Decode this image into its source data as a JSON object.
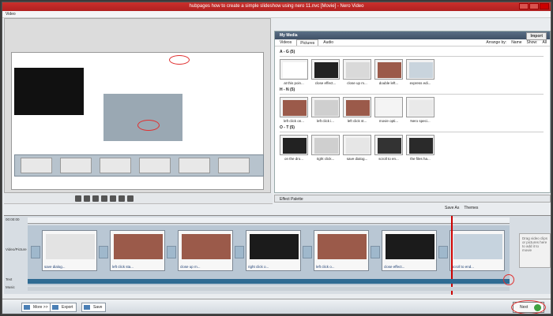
{
  "window": {
    "title": "hubpages how to create a simple slideshow using nero 11.nvc [Movie] - Nero Video"
  },
  "menubar": {
    "label": "Video"
  },
  "media_panel": {
    "title": "My Media",
    "import_label": "Import",
    "tabs": [
      "Videos",
      "Pictures",
      "Audio"
    ],
    "arrange_label": "Arrange by:",
    "arrange_value": "Name",
    "show_label": "Show:",
    "show_value": "All",
    "groups": [
      {
        "label": "A - G (5)",
        "items": [
          "at this poin...",
          "close effect...",
          "close up m...",
          "double left...",
          "express edi..."
        ]
      },
      {
        "label": "H - N (5)",
        "items": [
          "left click on...",
          "left click i...",
          "left click st...",
          "movie opti...",
          "Nero speci..."
        ]
      },
      {
        "label": "O - T (5)",
        "items": [
          "on the dro...",
          "right click...",
          "save dialog...",
          "scroll to en...",
          "the files ha..."
        ]
      }
    ]
  },
  "effect_panel": {
    "label": "Effect Palette"
  },
  "right_toolbar": {
    "save_as": "Save As",
    "themes": "Themes"
  },
  "timeline": {
    "track_labels": [
      "00:00:00",
      "Video/Picture",
      "Text",
      "Music"
    ],
    "clips": [
      "save dialog...",
      "left click sta...",
      "close up m...",
      "right click o...",
      "left click o...",
      "close effect...",
      "scroll to end..."
    ],
    "drop_text": "Drag video clips or pictures here to add it to movie"
  },
  "bottombar": {
    "more": "More >>",
    "export": "Export",
    "save": "Save",
    "next": "Next"
  }
}
